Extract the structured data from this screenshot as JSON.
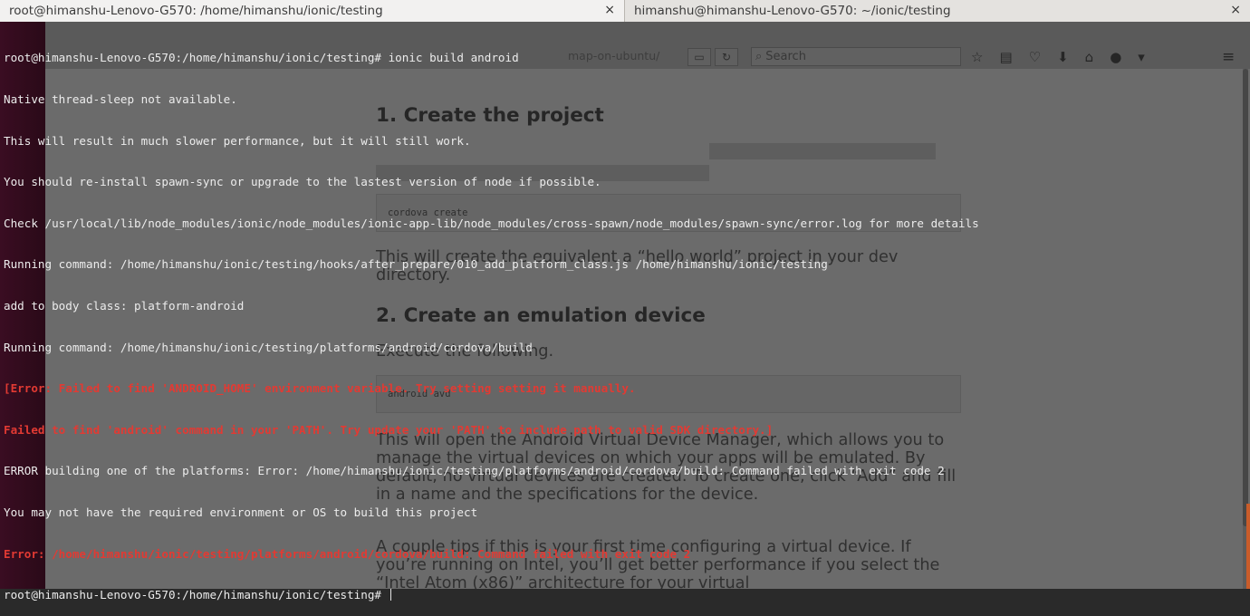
{
  "tabs": [
    {
      "title": "root@himanshu-Lenovo-G570: /home/himanshu/ionic/testing",
      "active": true
    },
    {
      "title": "himanshu@himanshu-Lenovo-G570: ~/ionic/testing",
      "active": false
    }
  ],
  "close_glyph": "×",
  "browser": {
    "url_tail": "map-on-ubuntu/",
    "search_placeholder": "Search",
    "icons": [
      "star-icon",
      "reading-list-icon",
      "pocket-icon",
      "download-icon",
      "home-icon",
      "chat-icon",
      "extensions-icon",
      "menu-icon"
    ]
  },
  "document": {
    "heading1": "1. Create the project",
    "code1": "cordova create",
    "para1": "This will create the equivalent a “hello world” project in your dev directory.",
    "heading2": "2. Create an emulation device",
    "para2": "Execute the following.",
    "code2": "android avd",
    "para3": "This will open the Android Virtual Device Manager, which allows you to manage the virtual devices on which your apps will be emulated. By default, no virtual devices are created. To create one, click “Add” and fill in a name and the specifications for the device.",
    "para4": "A couple tips if this is your first time configuring a virtual device. If you’re running on Intel, you’ll get better performance if you select the “Intel Atom (x86)” architecture for your virtual"
  },
  "terminal": {
    "lines": [
      {
        "text": "root@himanshu-Lenovo-G570:/home/himanshu/ionic/testing# ionic build android",
        "style": "normal"
      },
      {
        "text": "Native thread-sleep not available.",
        "style": "normal"
      },
      {
        "text": "This will result in much slower performance, but it will still work.",
        "style": "normal"
      },
      {
        "text": "You should re-install spawn-sync or upgrade to the lastest version of node if possible.",
        "style": "normal"
      },
      {
        "text": "Check /usr/local/lib/node_modules/ionic/node_modules/ionic-app-lib/node_modules/cross-spawn/node_modules/spawn-sync/error.log for more details",
        "style": "normal"
      },
      {
        "text": "Running command: /home/himanshu/ionic/testing/hooks/after_prepare/010_add_platform_class.js /home/himanshu/ionic/testing",
        "style": "normal"
      },
      {
        "text": "add to body class: platform-android",
        "style": "normal"
      },
      {
        "text": "Running command: /home/himanshu/ionic/testing/platforms/android/cordova/build",
        "style": "normal"
      },
      {
        "text": "[Error: Failed to find 'ANDROID_HOME' environment variable. Try setting setting it manually.",
        "style": "err-bold"
      },
      {
        "text": "Failed to find 'android' command in your 'PATH'. Try update your 'PATH' to include path to valid SDK directory.]",
        "style": "err-bold"
      },
      {
        "text": "ERROR building one of the platforms: Error: /home/himanshu/ionic/testing/platforms/android/cordova/build: Command failed with exit code 2",
        "style": "normal"
      },
      {
        "text": "You may not have the required environment or OS to build this project",
        "style": "normal"
      },
      {
        "text": "Error: /home/himanshu/ionic/testing/platforms/android/cordova/build: Command failed with exit code 2",
        "style": "err-bold"
      },
      {
        "text": "root@himanshu-Lenovo-G570:/home/himanshu/ionic/testing# ",
        "style": "prompt"
      }
    ]
  }
}
